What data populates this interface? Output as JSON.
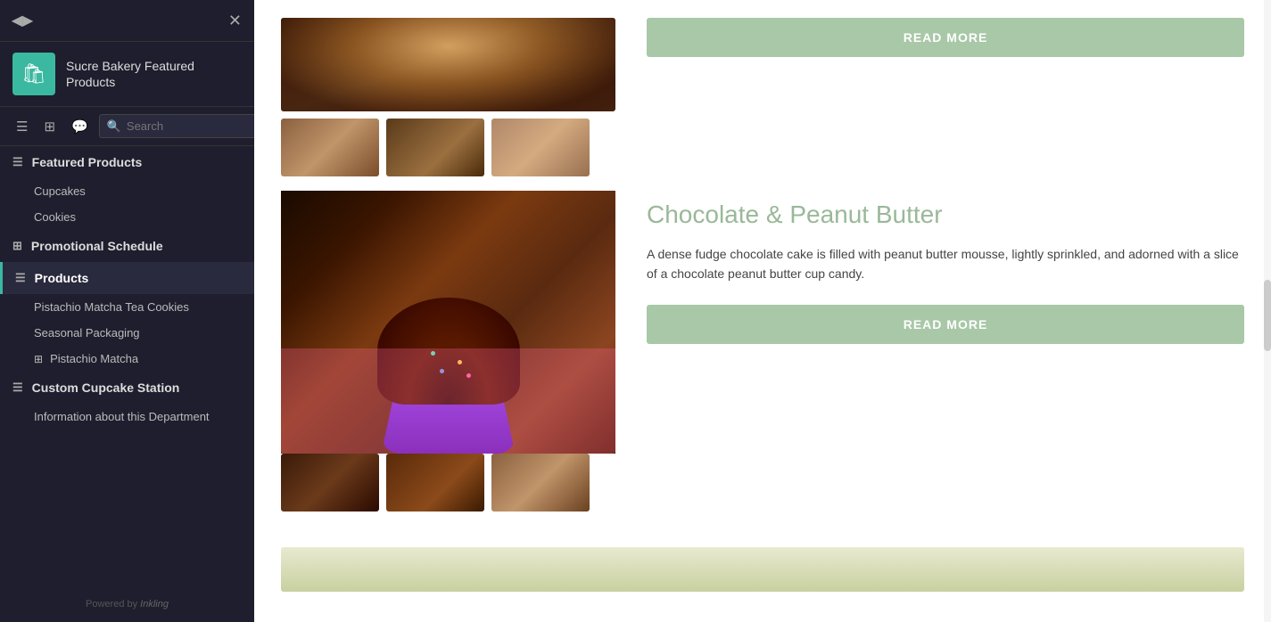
{
  "app": {
    "logo_label": "◀▶",
    "close_label": "✕",
    "title": "Sucre Bakery Featured Products",
    "icon_symbol": "🛍"
  },
  "toolbar": {
    "list_icon": "≡",
    "card_icon": "▤",
    "comment_icon": "💬",
    "search_placeholder": "Search",
    "search_close": "✕"
  },
  "nav": {
    "featured_products": {
      "label": "Featured Products",
      "icon": "≡",
      "children": [
        {
          "label": "Cupcakes"
        },
        {
          "label": "Cookies"
        }
      ]
    },
    "promotional_schedule": {
      "label": "Promotional Schedule",
      "icon": "▤"
    },
    "products": {
      "label": "Products",
      "icon": "≡",
      "children": [
        {
          "label": "Pistachio Matcha Tea Cookies"
        },
        {
          "label": "Seasonal Packaging"
        },
        {
          "sub_icon": "▤",
          "label": "Pistachio Matcha"
        }
      ]
    },
    "custom_cupcake_station": {
      "label": "Custom Cupcake Station",
      "icon": "≡",
      "children": [
        {
          "label": "Information about this Department"
        }
      ]
    }
  },
  "footer": {
    "powered_by": "Powered by",
    "brand": "Inkling"
  },
  "products": [
    {
      "title": "Chocolate & Peanut Butter",
      "description": "A dense fudge chocolate cake is filled with peanut butter mousse, lightly sprinkled, and adorned with a slice of a chocolate peanut butter cup candy.",
      "read_more": "READ MORE"
    }
  ]
}
